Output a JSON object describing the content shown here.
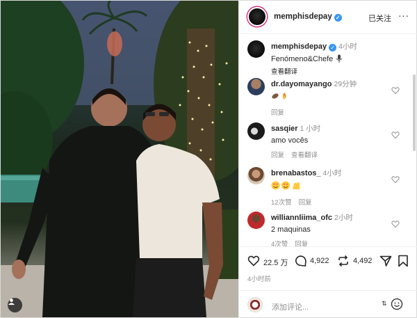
{
  "post": {
    "username": "memphisdepay",
    "follow_label": "已关注",
    "more_label": "···",
    "caption": {
      "username": "memphisdepay",
      "time": "4小时",
      "text": "Fenómeno&Chefe",
      "translate": "查看翻译"
    }
  },
  "comments": [
    {
      "username": "dr.dayomayango",
      "time": "29分钟",
      "text": "",
      "actions": [
        "回复"
      ]
    },
    {
      "username": "sasqier",
      "time": "1 小时",
      "text": "amo vocês",
      "actions": [
        "回复",
        "查看翻译"
      ]
    },
    {
      "username": "brenabastos_",
      "time": "4小时",
      "text": "",
      "actions": [
        "12次赞",
        "回复"
      ]
    },
    {
      "username": "williannliima_ofc",
      "time": "2小时",
      "text": "2 maquinas",
      "actions": [
        "4次赞",
        "回复"
      ]
    }
  ],
  "stats": {
    "likes": "22.5 万",
    "comments": "4,922",
    "reposts": "4,492",
    "posted_ago": "4小时前"
  },
  "composer": {
    "placeholder": "添加评论..."
  },
  "colors": {
    "verified": "#3897f0",
    "story_ring": "#d52e7f",
    "muted": "#8e8e8e"
  }
}
